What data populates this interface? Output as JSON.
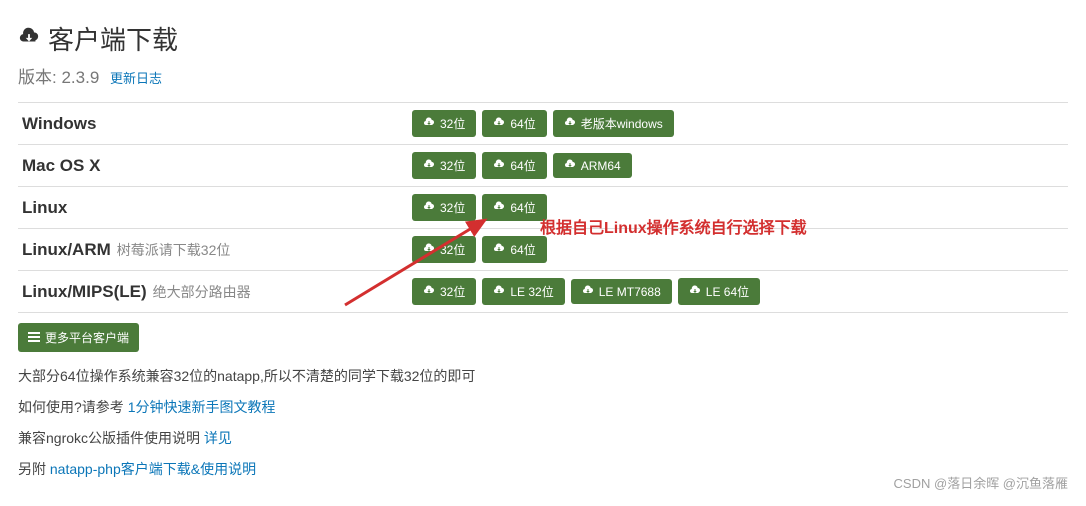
{
  "header": {
    "title": "客户端下载",
    "version_label": "版本:",
    "version": "2.3.9",
    "changelog_label": "更新日志"
  },
  "rows": [
    {
      "os": "Windows",
      "sub": "",
      "buttons": [
        {
          "label": "32位"
        },
        {
          "label": "64位"
        },
        {
          "label": "老版本windows"
        }
      ]
    },
    {
      "os": "Mac OS X",
      "sub": "",
      "buttons": [
        {
          "label": "32位"
        },
        {
          "label": "64位"
        },
        {
          "label": "ARM64"
        }
      ]
    },
    {
      "os": "Linux",
      "sub": "",
      "buttons": [
        {
          "label": "32位"
        },
        {
          "label": "64位"
        }
      ]
    },
    {
      "os": "Linux/ARM",
      "sub": "树莓派请下载32位",
      "buttons": [
        {
          "label": "32位"
        },
        {
          "label": "64位"
        }
      ]
    },
    {
      "os": "Linux/MIPS(LE)",
      "sub": "绝大部分路由器",
      "buttons": [
        {
          "label": "32位"
        },
        {
          "label": "LE 32位"
        },
        {
          "label": "LE MT7688"
        },
        {
          "label": "LE 64位"
        }
      ]
    }
  ],
  "more_platforms_label": "更多平台客户端",
  "notes": {
    "line1": "大部分64位操作系统兼容32位的natapp,所以不清楚的同学下载32位的即可",
    "line2_prefix": "如何使用?请参考 ",
    "line2_link": "1分钟快速新手图文教程",
    "line3_prefix": "兼容ngrokc公版插件使用说明 ",
    "line3_link": "详见",
    "line4_prefix": "另附 ",
    "line4_link": "natapp-php客户端下载&使用说明"
  },
  "annotation_text": "根据自己Linux操作系统自行选择下载",
  "watermark": "CSDN @落日余晖 @沉鱼落雁",
  "icons": {
    "cloud": "cloud-download-icon",
    "list": "list-icon"
  }
}
